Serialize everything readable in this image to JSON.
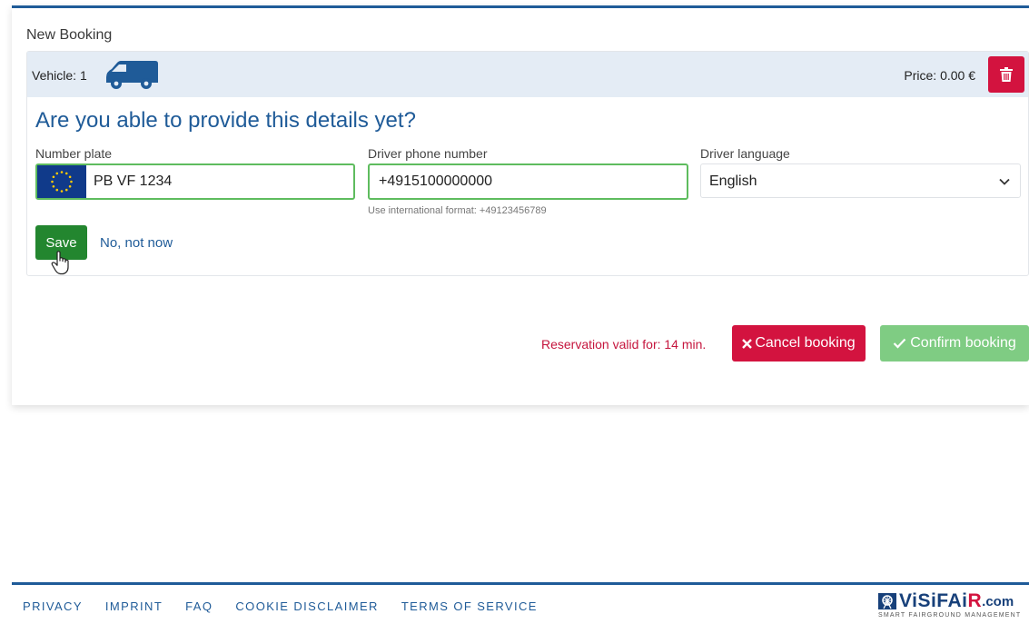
{
  "booking": {
    "title": "New Booking",
    "vehicle_label": "Vehicle:",
    "vehicle_count": "1",
    "price_label": "Price: 0.00 €",
    "question": "Are you able to provide this details yet?",
    "fields": {
      "plate_label": "Number plate",
      "plate_value": "PB VF 1234",
      "phone_label": "Driver phone number",
      "phone_value": "+4915100000000",
      "phone_hint": "Use international format: +49123456789",
      "language_label": "Driver language",
      "language_value": "English"
    },
    "save_label": "Save",
    "not_now_label": "No, not now",
    "reservation_text": "Reservation valid for: 14 min.",
    "cancel_label": "Cancel booking",
    "confirm_label": "Confirm booking"
  },
  "footer": {
    "links": [
      "PRIVACY",
      "IMPRINT",
      "FAQ",
      "COOKIE DISCLAIMER",
      "TERMS OF SERVICE"
    ]
  },
  "logo": {
    "name_main": "ViSiFAi",
    "name_accent": "R",
    "domain": ".com",
    "tagline": "SMART FAIRGROUND MANAGEMENT"
  },
  "colors": {
    "primary": "#1f5b98",
    "danger": "#d3133f",
    "success": "#23862f",
    "confirm_disabled": "#7fcc83",
    "valid_border": "#5ebc5e",
    "vehicle_bar": "#e4ecf5"
  },
  "icons": [
    "van-icon",
    "trash-icon",
    "eu-flag-icon",
    "chevron-down-icon",
    "hand-cursor-icon",
    "x-icon",
    "check-icon",
    "visifair-logo-icon"
  ]
}
